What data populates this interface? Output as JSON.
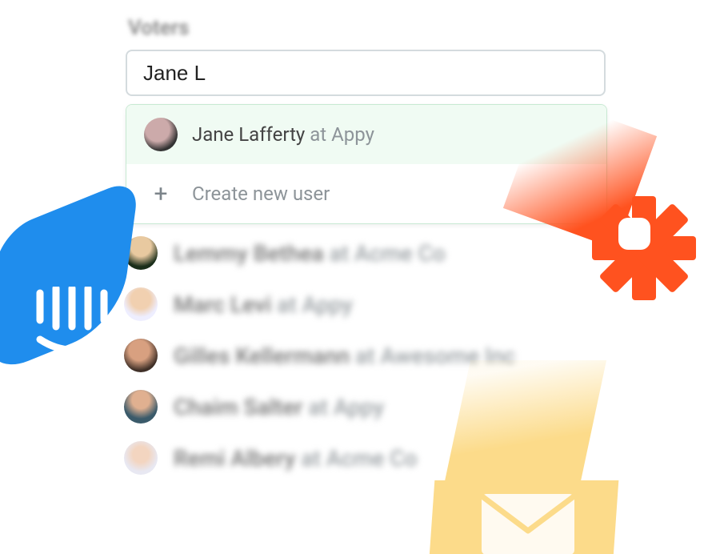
{
  "field_label": "Voters",
  "search": {
    "value": "Jane L"
  },
  "dropdown": {
    "suggestion": {
      "name": "Jane Lafferty",
      "at_word": "at",
      "company": "Appy"
    },
    "create_label": "Create new user"
  },
  "users": [
    {
      "name": "Lemmy Bethea",
      "at_word": "at",
      "company": "Acme Co"
    },
    {
      "name": "Marc Levi",
      "at_word": "at",
      "company": "Appy"
    },
    {
      "name": "Gilles Kellermann",
      "at_word": "at",
      "company": "Awesome Inc"
    },
    {
      "name": "Chaim Salter",
      "at_word": "at",
      "company": "Appy"
    },
    {
      "name": "Remi Albery",
      "at_word": "at",
      "company": "Acme Co"
    }
  ],
  "decorations": {
    "blue_icon": "intercom-logo",
    "orange_icon": "zapier-logo",
    "cream_icon": "mail-icon"
  }
}
